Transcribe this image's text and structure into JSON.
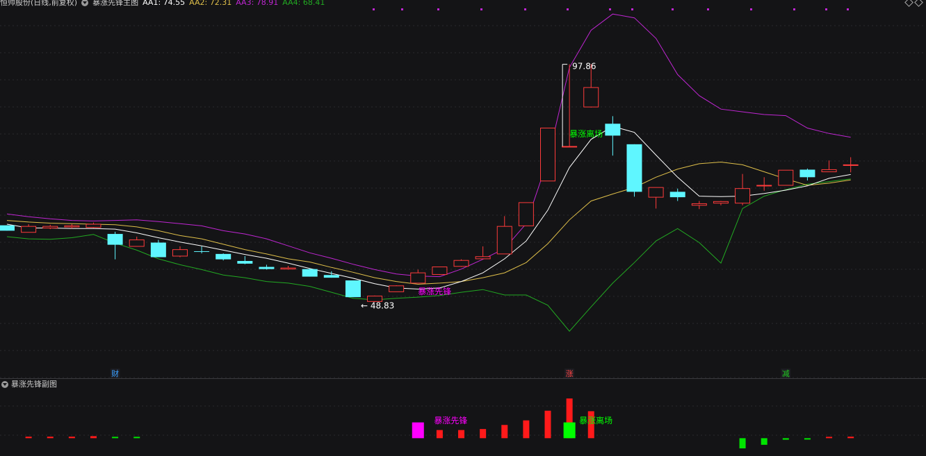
{
  "header": {
    "stock": "恒帅股份(日线,前复权)",
    "indicator": "暴涨先锋主图",
    "aa1_label": "AA1:",
    "aa1_value": "74.55",
    "aa1_color": "#ffffff",
    "aa2_label": "AA2:",
    "aa2_value": "72.31",
    "aa2_color": "#e0c04a",
    "aa3_label": "AA3:",
    "aa3_value": "78.91",
    "aa3_color": "#c026d3",
    "aa4_label": "AA4:",
    "aa4_value": "68.41",
    "aa4_color": "#22aa22"
  },
  "sub_header": {
    "title": "暴涨先锋副图"
  },
  "chart_data": {
    "type": "candlestick",
    "ylim": [
      43,
      108
    ],
    "colors": {
      "up": "#ff3b3b",
      "down": "#5ff6ff",
      "aa1": "#ffffff",
      "aa2": "#e0c04a",
      "aa3": "#c026d3",
      "aa4": "#22aa22",
      "signal_pioneer": "#ff00ff",
      "signal_exit": "#00ff00"
    },
    "candles": [
      {
        "o": 68.1,
        "c": 67.1,
        "h": 68.1,
        "l": 67.1
      },
      {
        "o": 66.8,
        "c": 67.9,
        "h": 68.3,
        "l": 66.8
      },
      {
        "o": 67.6,
        "c": 67.9,
        "h": 68.2,
        "l": 67.4
      },
      {
        "o": 67.8,
        "c": 68.0,
        "h": 68.3,
        "l": 67.5
      },
      {
        "o": 67.7,
        "c": 68.3,
        "h": 68.6,
        "l": 67.6
      },
      {
        "o": 66.5,
        "c": 64.5,
        "h": 66.9,
        "l": 61.8
      },
      {
        "o": 64.2,
        "c": 65.4,
        "h": 66.0,
        "l": 64.2
      },
      {
        "o": 64.9,
        "c": 62.2,
        "h": 65.4,
        "l": 62.2
      },
      {
        "o": 62.4,
        "c": 63.6,
        "h": 64.2,
        "l": 62.2
      },
      {
        "o": 63.3,
        "c": 63.2,
        "h": 64.2,
        "l": 62.9
      },
      {
        "o": 62.8,
        "c": 61.8,
        "h": 62.9,
        "l": 61.6
      },
      {
        "o": 61.5,
        "c": 61.0,
        "h": 62.4,
        "l": 60.9
      },
      {
        "o": 60.4,
        "c": 60.0,
        "h": 60.8,
        "l": 59.9
      },
      {
        "o": 60.0,
        "c": 60.2,
        "h": 60.6,
        "l": 59.9
      },
      {
        "o": 60.0,
        "c": 58.6,
        "h": 60.1,
        "l": 58.6
      },
      {
        "o": 58.9,
        "c": 58.4,
        "h": 59.6,
        "l": 58.4
      },
      {
        "o": 57.9,
        "c": 54.8,
        "h": 57.9,
        "l": 54.8
      },
      {
        "o": 54.0,
        "c": 55.0,
        "h": 55.1,
        "l": 53.9
      },
      {
        "o": 55.8,
        "c": 56.9,
        "h": 57.0,
        "l": 55.8
      },
      {
        "o": 57.4,
        "c": 59.3,
        "h": 59.9,
        "l": 57.4
      },
      {
        "o": 59.0,
        "c": 60.4,
        "h": 60.4,
        "l": 58.9
      },
      {
        "o": 60.5,
        "c": 61.6,
        "h": 61.8,
        "l": 60.4
      },
      {
        "o": 61.9,
        "c": 62.3,
        "h": 64.2,
        "l": 61.9
      },
      {
        "o": 62.8,
        "c": 67.9,
        "h": 69.8,
        "l": 62.8
      },
      {
        "o": 68.0,
        "c": 72.3,
        "h": 72.3,
        "l": 68.0
      },
      {
        "o": 76.3,
        "c": 86.1,
        "h": 86.1,
        "l": 76.3
      },
      {
        "o": 82.7,
        "c": 82.7,
        "h": 97.9,
        "l": 82.7
      },
      {
        "o": 90.0,
        "c": 93.6,
        "h": 97.9,
        "l": 89.9
      },
      {
        "o": 86.9,
        "c": 84.7,
        "h": 88.3,
        "l": 81.0
      },
      {
        "o": 83.1,
        "c": 74.3,
        "h": 83.1,
        "l": 73.4
      },
      {
        "o": 73.3,
        "c": 75.1,
        "h": 75.1,
        "l": 71.2
      },
      {
        "o": 74.3,
        "c": 73.3,
        "h": 74.9,
        "l": 72.6
      },
      {
        "o": 71.8,
        "c": 72.1,
        "h": 72.6,
        "l": 71.1
      },
      {
        "o": 72.2,
        "c": 72.5,
        "h": 72.6,
        "l": 71.8
      },
      {
        "o": 72.2,
        "c": 74.9,
        "h": 77.6,
        "l": 71.8
      },
      {
        "o": 75.5,
        "c": 75.5,
        "h": 77.0,
        "l": 74.5
      },
      {
        "o": 75.5,
        "c": 78.3,
        "h": 78.3,
        "l": 75.5
      },
      {
        "o": 78.4,
        "c": 77.0,
        "h": 78.6,
        "l": 76.4
      },
      {
        "o": 78.0,
        "c": 78.4,
        "h": 80.1,
        "l": 78.0
      },
      {
        "o": 79.3,
        "c": 79.3,
        "h": 80.7,
        "l": 77.9
      }
    ],
    "aa1": [
      68.3,
      67.6,
      67.6,
      67.5,
      67.5,
      67.4,
      66.7,
      65.8,
      65.0,
      64.3,
      63.5,
      62.7,
      62.0,
      61.1,
      60.1,
      59.2,
      58.3,
      57.3,
      56.5,
      56.3,
      56.5,
      57.7,
      59.3,
      61.9,
      65.2,
      70.9,
      78.8,
      84.0,
      86.4,
      85.3,
      81.1,
      77.0,
      73.5,
      73.4,
      73.5,
      74.0,
      74.6,
      75.4,
      76.8,
      77.5
    ],
    "aa2": [
      69.0,
      68.7,
      68.5,
      68.4,
      68.3,
      68.2,
      67.8,
      67.1,
      66.2,
      65.6,
      64.6,
      63.6,
      62.8,
      61.9,
      61.3,
      60.3,
      59.4,
      58.4,
      57.7,
      57.2,
      57.4,
      57.7,
      58.4,
      59.3,
      61.2,
      64.7,
      69.1,
      72.6,
      73.9,
      75.1,
      77.0,
      78.5,
      79.5,
      79.8,
      79.3,
      78.0,
      76.7,
      75.5,
      75.9,
      76.5
    ],
    "aa3": [
      70.2,
      69.7,
      69.3,
      69.0,
      68.9,
      69.0,
      69.1,
      68.8,
      68.4,
      68.0,
      67.1,
      66.5,
      65.6,
      64.3,
      63.0,
      62.0,
      60.9,
      59.9,
      59.1,
      58.7,
      58.6,
      60.0,
      61.8,
      63.8,
      68.4,
      80.2,
      97.3,
      104.2,
      107.2,
      106.5,
      102.7,
      96.0,
      92.1,
      89.6,
      89.1,
      88.6,
      88.4,
      86.1,
      85.1,
      84.4
    ],
    "aa4": [
      66.0,
      65.6,
      65.5,
      65.8,
      66.4,
      64.8,
      63.5,
      61.9,
      60.8,
      59.9,
      58.9,
      58.4,
      57.7,
      57.4,
      56.8,
      55.7,
      54.6,
      54.3,
      54.6,
      54.8,
      55.1,
      55.7,
      56.2,
      55.2,
      55.2,
      53.3,
      48.5,
      53.0,
      57.4,
      61.2,
      65.2,
      67.5,
      64.9,
      61.1,
      71.2,
      73.5,
      74.7,
      75.7,
      76.2,
      76.7
    ],
    "annotations": {
      "high_label": "97.86",
      "low_label": "48.83",
      "pioneer_label": "暴涨先锋",
      "exit_label": "暴涨离场"
    },
    "markers": [
      {
        "index": 5,
        "label": "财",
        "color": "#3ba0ff"
      },
      {
        "index": 26,
        "label": "涨",
        "color": "#ff4444"
      },
      {
        "index": 36,
        "label": "减",
        "color": "#22cc22"
      }
    ],
    "sub_chart": {
      "title": "暴涨先锋副图",
      "ylim": [
        -2,
        10
      ],
      "bars": [
        {
          "index": 1,
          "value": 0.3,
          "kind": "red"
        },
        {
          "index": 2,
          "value": 0.3,
          "kind": "red"
        },
        {
          "index": 3,
          "value": 0.3,
          "kind": "red"
        },
        {
          "index": 4,
          "value": 0.4,
          "kind": "red"
        },
        {
          "index": 5,
          "value": 0.2,
          "kind": "green"
        },
        {
          "index": 6,
          "value": 0.2,
          "kind": "green"
        },
        {
          "index": 19,
          "value": 3.1,
          "kind": "magenta"
        },
        {
          "index": 20,
          "value": 1.6,
          "kind": "red"
        },
        {
          "index": 21,
          "value": 1.6,
          "kind": "red"
        },
        {
          "index": 22,
          "value": 1.8,
          "kind": "red"
        },
        {
          "index": 23,
          "value": 2.6,
          "kind": "red"
        },
        {
          "index": 24,
          "value": 3.5,
          "kind": "red"
        },
        {
          "index": 25,
          "value": 5.4,
          "kind": "red"
        },
        {
          "index": 26,
          "value": 7.8,
          "kind": "red"
        },
        {
          "index": 27,
          "value": 5.3,
          "kind": "red"
        },
        {
          "index": 26,
          "value": 3.1,
          "kind": "green_big"
        },
        {
          "index": 34,
          "value": -2.0,
          "kind": "green"
        },
        {
          "index": 35,
          "value": -1.3,
          "kind": "green"
        },
        {
          "index": 36,
          "value": -0.3,
          "kind": "green"
        },
        {
          "index": 37,
          "value": -0.2,
          "kind": "green"
        },
        {
          "index": 38,
          "value": 0.2,
          "kind": "red"
        },
        {
          "index": 39,
          "value": 0.3,
          "kind": "red"
        }
      ]
    }
  }
}
